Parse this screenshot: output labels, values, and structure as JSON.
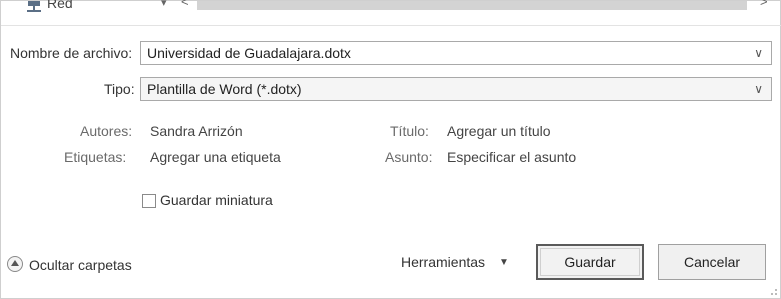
{
  "topbar": {
    "folder_label": "Red",
    "nav_chevron": "▾",
    "nav_left": "<",
    "nav_right": ">"
  },
  "form": {
    "filename_label": "Nombre de archivo:",
    "filename_value": "Universidad de Guadalajara.dotx",
    "type_label": "Tipo:",
    "type_value": "Plantilla de Word (*.dotx)",
    "dropdown_arrow": "∨"
  },
  "metadata": {
    "authors_label": "Autores:",
    "authors_value": "Sandra Arrizón",
    "tags_label": "Etiquetas:",
    "tags_value": "Agregar una etiqueta",
    "title_label": "Título:",
    "title_value": "Agregar un título",
    "subject_label": "Asunto:",
    "subject_value": "Especificar el asunto"
  },
  "thumbnail": {
    "label": "Guardar miniatura",
    "checked": false
  },
  "footer": {
    "hide_folders_label": "Ocultar carpetas",
    "tools_label": "Herramientas",
    "tools_arrow": "▼",
    "save_label": "Guardar",
    "cancel_label": "Cancelar"
  },
  "colors": {
    "field_border": "#a9a9a9",
    "button_bg": "#f0f0f0",
    "label_gray": "#6a6a6a",
    "scroll_track": "#d3d3d3"
  },
  "icons": [
    "network-icon",
    "chevron-down-icon",
    "dropdown-arrow-icon",
    "checkbox-icon",
    "collapse-arrow-icon",
    "resize-grip-icon"
  ]
}
